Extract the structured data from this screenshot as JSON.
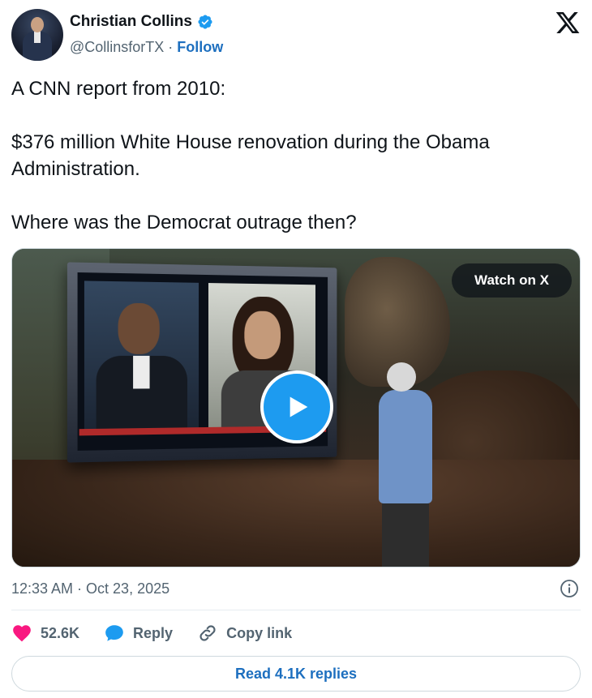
{
  "author": {
    "name": "Christian Collins",
    "handle": "@CollinsforTX",
    "separator": "·",
    "follow_label": "Follow",
    "verified": true
  },
  "tweet": {
    "paragraphs": [
      "A CNN report from 2010:",
      "$376 million White House renovation during the Obama Administration.",
      "Where was the Democrat outrage then?"
    ]
  },
  "media": {
    "watch_label": "Watch on X",
    "play_icon": "play-icon"
  },
  "meta": {
    "timestamp": "12:33 AM · Oct 23, 2025",
    "info_icon": "info-icon"
  },
  "actions": {
    "likes": "52.6K",
    "reply_label": "Reply",
    "copy_link_label": "Copy link"
  },
  "read_replies_label": "Read 4.1K replies",
  "colors": {
    "accent": "#1d9bf0",
    "link": "#1d6fbf",
    "like": "#f91880",
    "text": "#0f1419",
    "muted": "#536471"
  }
}
